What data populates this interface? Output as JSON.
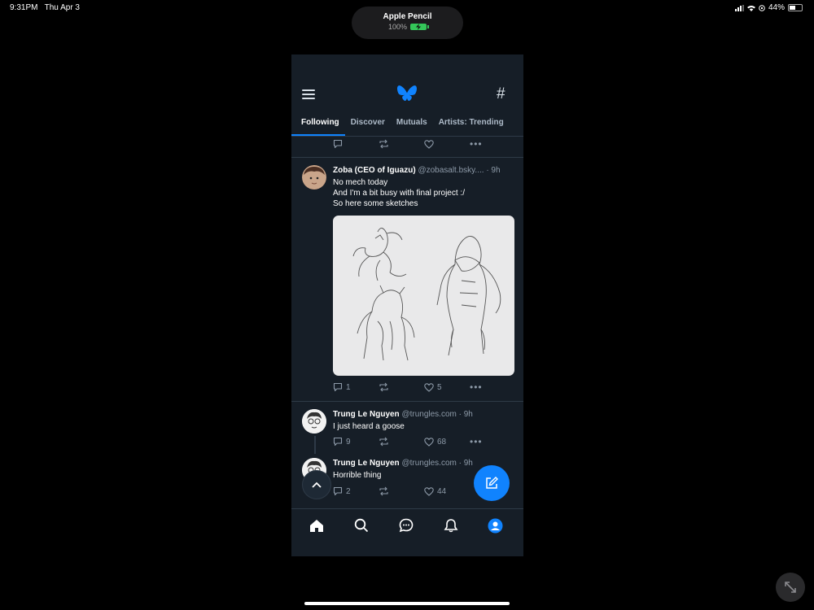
{
  "status_bar": {
    "time": "9:31PM",
    "date": "Thu Apr 3",
    "battery": "44%",
    "battery_level": 0.44
  },
  "pencil": {
    "name": "Apple Pencil",
    "battery": "100%"
  },
  "feed_tabs": [
    "Following",
    "Discover",
    "Mutuals",
    "Artists: Trending"
  ],
  "active_tab": "Following",
  "prev_post": {
    "reply_count": "",
    "like_count": ""
  },
  "posts": [
    {
      "name": "Zoba (CEO of Iguazu)",
      "handle": "@zobasalt.bsky....",
      "time": "· 9h",
      "lines": [
        "No mech today",
        "And I'm a bit busy with final project :/",
        "So here some sketches"
      ],
      "reply_count": "1",
      "repost_count": "",
      "like_count": "5"
    },
    {
      "name": "Trung Le Nguyen",
      "handle": "@trungles.com",
      "time": "· 9h",
      "lines": [
        "I just heard a goose"
      ],
      "reply_count": "9",
      "repost_count": "",
      "like_count": "68"
    },
    {
      "name": "Trung Le Nguyen",
      "handle": "@trungles.com",
      "time": "· 9h",
      "lines": [
        "Horrible thing"
      ],
      "reply_count": "2",
      "repost_count": "",
      "like_count": "44"
    }
  ],
  "icons": {
    "menu": "menu-icon",
    "logo": "butterfly-logo-icon",
    "feeds": "hash-icon",
    "reply": "reply-icon",
    "repost": "repost-icon",
    "like": "heart-icon",
    "more": "more-icon",
    "compose": "compose-icon",
    "scroll_top": "chevron-up-icon",
    "nav": [
      "home-icon",
      "search-icon",
      "chat-icon",
      "bell-icon",
      "profile-icon"
    ]
  },
  "colors": {
    "accent": "#1083fe",
    "background": "#161e27",
    "muted": "#8d9aa8"
  }
}
